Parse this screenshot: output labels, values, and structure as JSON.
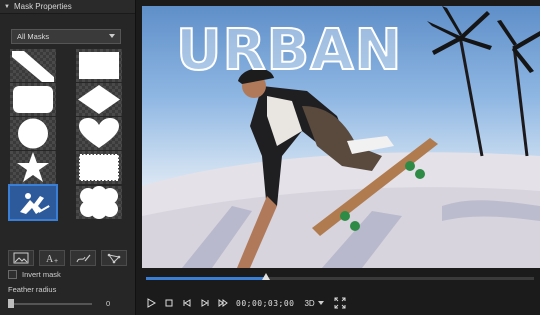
{
  "panel": {
    "title": "Mask Properties",
    "dropdown_value": "All Masks"
  },
  "mask_library": [
    {
      "name": "diagonal-bar-mask",
      "selected": false
    },
    {
      "name": "rectangle-mask",
      "selected": false
    },
    {
      "name": "rounded-rectangle-mask",
      "selected": false
    },
    {
      "name": "diamond-mask",
      "selected": false
    },
    {
      "name": "circle-mask",
      "selected": false
    },
    {
      "name": "heart-mask",
      "selected": false
    },
    {
      "name": "star-mask",
      "selected": false
    },
    {
      "name": "stamp-edge-mask",
      "selected": false
    },
    {
      "name": "skater-photo-mask",
      "selected": true
    },
    {
      "name": "cloud-mask",
      "selected": false
    }
  ],
  "tools": [
    "import-image-icon",
    "text-mask-icon",
    "freehand-brush-icon",
    "polygon-icon"
  ],
  "invert_mask_label": "Invert mask",
  "feather": {
    "label": "Feather radius",
    "value": "0"
  },
  "preview": {
    "overlay_text": "URBAN"
  },
  "playback": {
    "progress": 0.31,
    "timecode": "00;00;03;00",
    "mode": "3D"
  },
  "colors": {
    "accent": "#3a7fd5",
    "panel_bg": "#262626"
  }
}
